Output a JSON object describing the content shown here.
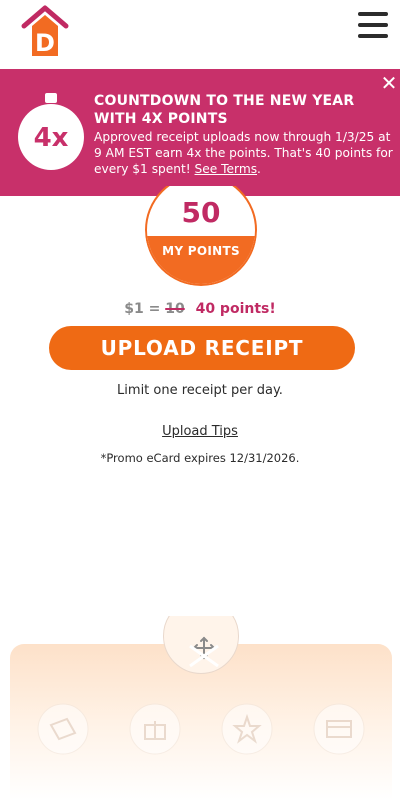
{
  "header": {
    "logo_letter": "D",
    "menu_icon": "hamburger-icon"
  },
  "banner": {
    "badge_text": "4x",
    "title": "COUNTDOWN TO THE NEW YEAR WITH 4X POINTS",
    "body": "Approved receipt uploads now through 1/3/25 at 9 AM EST earn 4x the points. That's 40 points for every $1 spent!",
    "link": "See Terms",
    "period": ".",
    "close_glyph": "✕",
    "background": "#c8306a"
  },
  "points": {
    "value": "50",
    "label": "MY POINTS"
  },
  "rate": {
    "prefix": "$1 =",
    "old_value": "10",
    "new_value": "40 points!"
  },
  "upload_button": "UPLOAD RECEIPT",
  "limit_text": "Limit one receipt per day.",
  "tips_link": "Upload Tips",
  "expiry_text": "*Promo eCard expires 12/31/2026.",
  "bottom_nav": {
    "icons": [
      "ticket-icon",
      "gift-icon",
      "star-icon",
      "card-icon",
      "move-icon"
    ]
  },
  "colors": {
    "brand_orange": "#ef6a14",
    "brand_pink": "#c02a63"
  }
}
